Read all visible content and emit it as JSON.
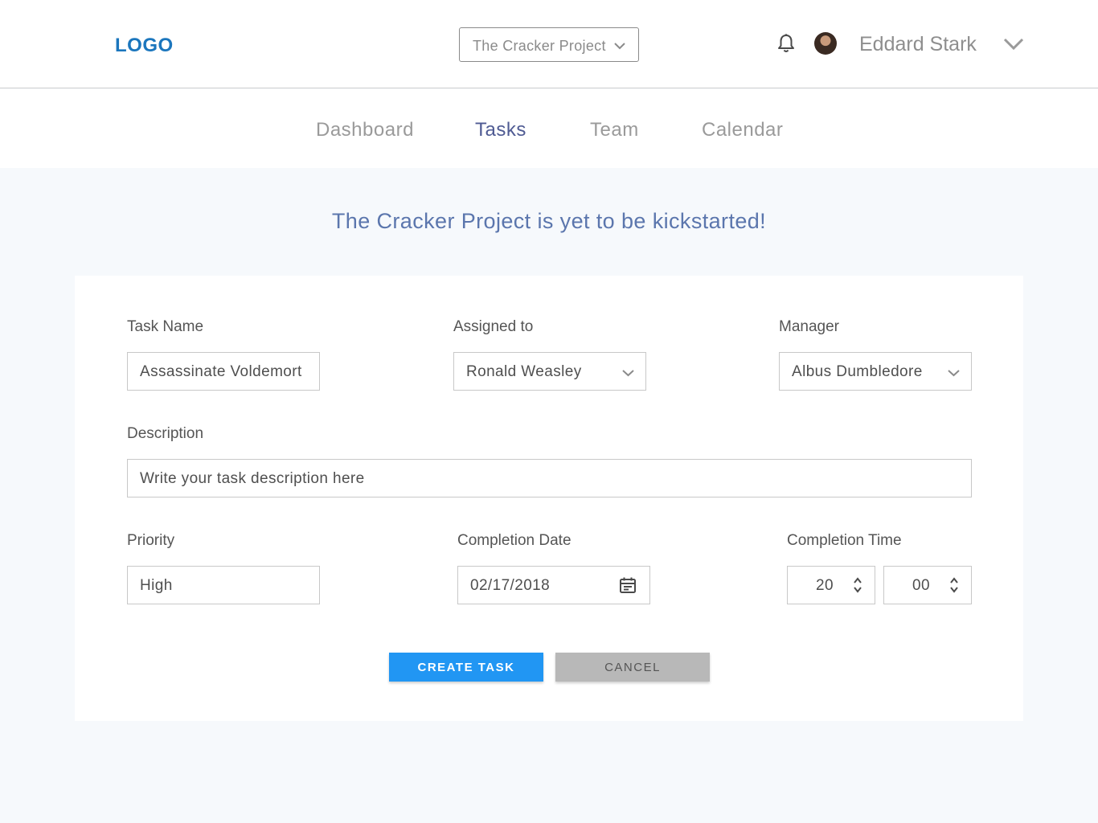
{
  "header": {
    "logo": "LOGO",
    "project_selector": "The Cracker Project",
    "user_name": "Eddard Stark"
  },
  "nav": {
    "items": [
      {
        "label": "Dashboard"
      },
      {
        "label": "Tasks",
        "active": true
      },
      {
        "label": "Team"
      },
      {
        "label": "Calendar"
      }
    ]
  },
  "banner": "The Cracker Project is yet to be kickstarted!",
  "form": {
    "task_name": {
      "label": "Task Name",
      "value": "Assassinate Voldemort"
    },
    "assigned_to": {
      "label": "Assigned to",
      "value": "Ronald Weasley"
    },
    "manager": {
      "label": "Manager",
      "value": "Albus Dumbledore"
    },
    "description": {
      "label": "Description",
      "placeholder": "Write your task description here"
    },
    "priority": {
      "label": "Priority",
      "value": "High"
    },
    "completion_date": {
      "label": "Completion Date",
      "value": "02/17/2018"
    },
    "completion_time": {
      "label": "Completion Time",
      "hour": "20",
      "minute": "00"
    }
  },
  "actions": {
    "create_label": "CREATE TASK",
    "cancel_label": "CANCEL"
  },
  "colors": {
    "accent": "#2196f3",
    "logo": "#1b76bd",
    "nav_active": "#4f5b93",
    "banner": "#5b76ad"
  },
  "icons": [
    "chevron-down-icon",
    "bell-icon",
    "calendar-icon",
    "spinner-icon"
  ]
}
